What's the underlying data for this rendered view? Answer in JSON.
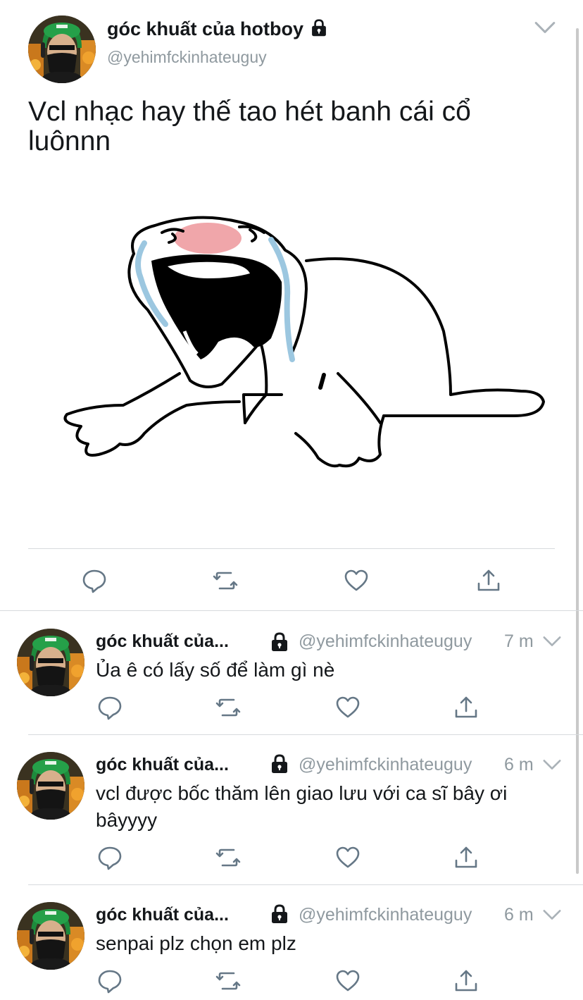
{
  "main_tweet": {
    "name": "góc khuất của hotboy",
    "handle": "@yehimfckinhateuguy",
    "text": "Vcl nhạc hay thế tao hét banh cái cổ luônnn"
  },
  "replies": [
    {
      "name": "góc khuất của...",
      "handle": "@yehimfckinhateuguy",
      "time": "7 m",
      "text": "Ủa ê có lấy số để làm gì nè"
    },
    {
      "name": "góc khuất của...",
      "handle": "@yehimfckinhateuguy",
      "time": "6 m",
      "text": "vcl được bốc thăm lên giao lưu với ca sĩ bây ơi bâyyyy"
    },
    {
      "name": "góc khuất của...",
      "handle": "@yehimfckinhateuguy",
      "time": "6 m",
      "text": "senpai plz chọn em plz"
    }
  ],
  "icons": [
    "reply-icon",
    "retweet-icon",
    "like-icon",
    "share-icon",
    "lock-icon",
    "chevron-down-icon"
  ],
  "colors": {
    "text": "#14171a",
    "secondary": "#8f999f",
    "icon": "#657786",
    "divider": "#d7dadd"
  }
}
